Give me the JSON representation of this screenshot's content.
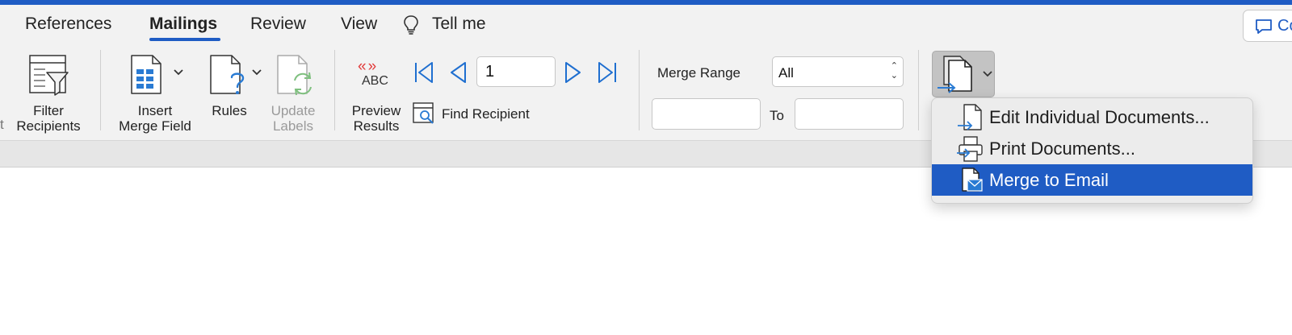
{
  "tabs": [
    {
      "label": "References",
      "active": false
    },
    {
      "label": "Mailings",
      "active": true
    },
    {
      "label": "Review",
      "active": false
    },
    {
      "label": "View",
      "active": false
    }
  ],
  "tell_me": {
    "label": "Tell me",
    "icon": "lightbulb-icon"
  },
  "comments": {
    "label": "Co",
    "icon": "comment-icon"
  },
  "ribbon": {
    "cut_label": "t",
    "filter_recipients": {
      "line1": "Filter",
      "line2": "Recipients",
      "icon": "filter-table-icon"
    },
    "insert_merge_field": {
      "line1": "Insert",
      "line2": "Merge Field",
      "icon": "merge-field-icon"
    },
    "rules": {
      "label": "Rules",
      "icon": "rules-icon"
    },
    "update_labels": {
      "line1": "Update",
      "line2": "Labels",
      "icon": "update-labels-icon",
      "disabled": true
    },
    "preview_results": {
      "line1": "Preview",
      "line2": "Results",
      "icon_text": "ABC",
      "icon_arrows": "«»"
    },
    "record_nav": {
      "value": "1"
    },
    "find_recipient": {
      "label": "Find Recipient",
      "icon": "find-recipient-icon"
    },
    "merge_range": {
      "label": "Merge Range",
      "selected": "All"
    },
    "range_to": {
      "label": "To",
      "from_value": "",
      "to_value": ""
    }
  },
  "finish_menu": {
    "items": [
      {
        "label": "Edit Individual Documents...",
        "icon": "edit-documents-icon",
        "selected": false
      },
      {
        "label": "Print Documents...",
        "icon": "printer-icon",
        "selected": false
      },
      {
        "label": "Merge to Email",
        "icon": "email-icon",
        "selected": true
      }
    ]
  },
  "colors": {
    "accent": "#1f5cc4",
    "ribbon_bg": "#f2f2f2",
    "preview_red": "#e23b3b",
    "nav_blue": "#1f6fd0",
    "update_green": "#7fc07f"
  }
}
